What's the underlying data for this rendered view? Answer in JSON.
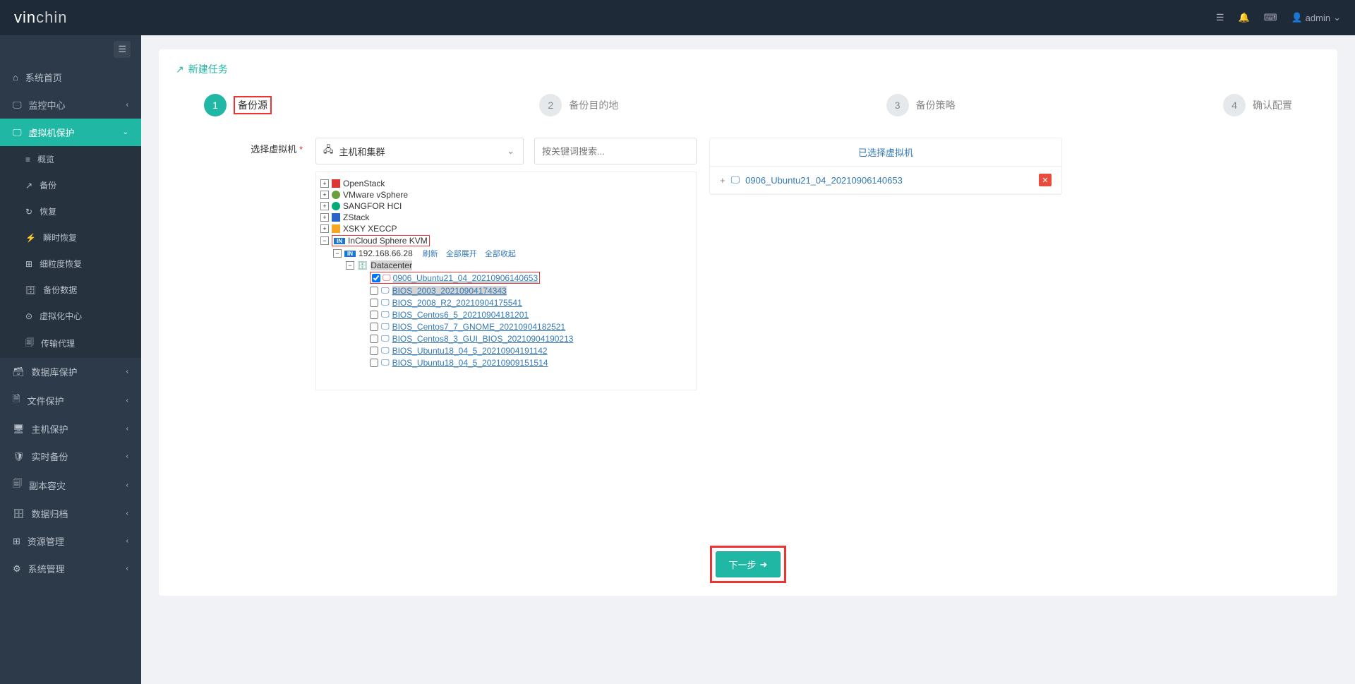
{
  "brand": {
    "p1": "vin",
    "p2": "chin"
  },
  "user": "admin",
  "sidebar": {
    "home": "系统首页",
    "monitor": "监控中心",
    "vm": "虚拟机保护",
    "sub": {
      "overview": "概览",
      "backup": "备份",
      "restore": "恢复",
      "instant": "瞬时恢复",
      "granular": "细粒度恢复",
      "data": "备份数据",
      "center": "虚拟化中心",
      "agent": "传输代理"
    },
    "db": "数据库保护",
    "file": "文件保护",
    "host": "主机保护",
    "rt": "实时备份",
    "dr": "副本容灾",
    "archive": "数据归档",
    "resource": "资源管理",
    "system": "系统管理"
  },
  "panel_title": "新建任务",
  "wizard": {
    "s1": {
      "n": "1",
      "label": "备份源"
    },
    "s2": {
      "n": "2",
      "label": "备份目的地"
    },
    "s3": {
      "n": "3",
      "label": "备份策略"
    },
    "s4": {
      "n": "4",
      "label": "确认配置"
    }
  },
  "select_vm_label": "选择虚拟机",
  "dropdown_label": "主机和集群",
  "search_placeholder": "按关键词搜索...",
  "tree": {
    "openstack": "OpenStack",
    "vmware": "VMware vSphere",
    "sangfor": "SANGFOR HCI",
    "zstack": "ZStack",
    "xsky": "XSKY XECCP",
    "incloud": "InCloud Sphere KVM",
    "ip": "192.168.66.28",
    "actions": {
      "refresh": "刷新",
      "expand": "全部展开",
      "collapse": "全部收起"
    },
    "datacenter": "Datacenter",
    "vms": {
      "v0": "0906_Ubuntu21_04_20210906140653",
      "v1": "BIOS_2003_20210904174343",
      "v2": "BIOS_2008_R2_20210904175541",
      "v3": "BIOS_Centos6_5_20210904181201",
      "v4": "BIOS_Centos7_7_GNOME_20210904182521",
      "v5": "BIOS_Centos8_3_GUI_BIOS_20210904190213",
      "v6": "BIOS_Ubuntu18_04_5_20210904191142",
      "v7": "BIOS_Ubuntu18_04_5_20210909151514"
    }
  },
  "selected_title": "已选择虚拟机",
  "selected_vm": "0906_Ubuntu21_04_20210906140653",
  "next_btn": "下一步"
}
